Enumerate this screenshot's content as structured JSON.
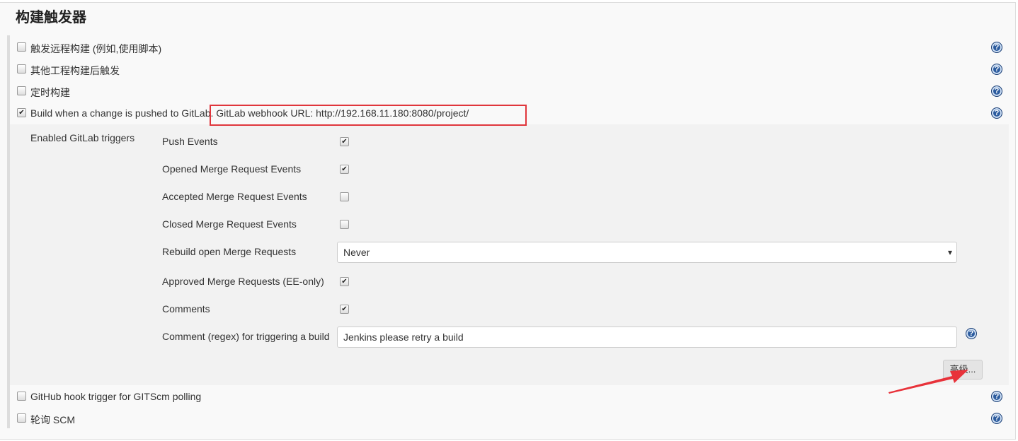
{
  "section_title": "构建触发器",
  "triggers": [
    {
      "label": "触发远程构建 (例如,使用脚本)",
      "checked": false
    },
    {
      "label": "其他工程构建后触发",
      "checked": false
    },
    {
      "label": "定时构建",
      "checked": false
    },
    {
      "label": "Build when a change is pushed to GitLab. GitLab webhook URL: http://192.168.11.180:8080/project/",
      "checked": true
    },
    {
      "label": "GitHub hook trigger for GITScm polling",
      "checked": false
    },
    {
      "label": "轮询 SCM",
      "checked": false
    }
  ],
  "gitlab": {
    "section_label": "Enabled GitLab triggers",
    "options": [
      {
        "label": "Push Events",
        "checked": true
      },
      {
        "label": "Opened Merge Request Events",
        "checked": true
      },
      {
        "label": "Accepted Merge Request Events",
        "checked": false
      },
      {
        "label": "Closed Merge Request Events",
        "checked": false
      },
      {
        "label": "Rebuild open Merge Requests",
        "type": "select",
        "value": "Never"
      },
      {
        "label": "Approved Merge Requests (EE-only)",
        "checked": true
      },
      {
        "label": "Comments",
        "checked": true
      },
      {
        "label": "Comment (regex) for triggering a build",
        "type": "input",
        "value": "Jenkins please retry a build"
      }
    ],
    "advanced_button": "高级..."
  },
  "icons": {
    "help": "help-icon",
    "check": "✔",
    "dropdown": "▾"
  },
  "colors": {
    "annotation": "#e0363c",
    "help": "#2b5b9e"
  }
}
